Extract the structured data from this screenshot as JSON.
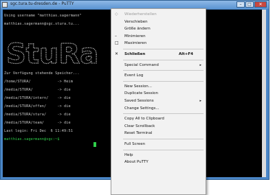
{
  "window": {
    "title": "sgc.tura.tu-dresden.de - PuTTY"
  },
  "terminal": {
    "lines": [
      "Using username \"matthias.sagermann\"",
      "matthias.sagermann@sgc.stura.tu...",
      "",
      "",
      "",
      "",
      "",
      "Zur Verfügung stehende Speicher...",
      "/home/STURA/            -> Heim",
      "/media/STURA/           -> die",
      "/media/STURA/intern/    -> die",
      "/media/STURA/offen/     -> die",
      "/media/STURA/stura/     -> die",
      "/media/STURA/team/      -> die",
      "Last login: Fri Dec  6 11:49:51",
      "matthias.sagermann@sgc:~$ "
    ],
    "banner_text": "StuRa",
    "cursor_color": "#2fcf4a"
  },
  "menu": {
    "items": [
      {
        "label": "Wiederherstellen",
        "icon": "restore-icon",
        "icon_char": "◇",
        "disabled": true
      },
      {
        "label": "Verschieben"
      },
      {
        "label": "Größe ändern"
      },
      {
        "label": "Minimieren",
        "icon": "minimize-icon",
        "icon_char": "–"
      },
      {
        "label": "Maximieren",
        "icon": "maximize-icon",
        "icon_char": "□"
      },
      {
        "sep": true
      },
      {
        "label": "Schließen",
        "icon": "close-icon",
        "icon_char": "✕",
        "shortcut": "Alt+F4",
        "bold": true
      },
      {
        "sep": true
      },
      {
        "label": "Special Command",
        "submenu": true
      },
      {
        "sep": true
      },
      {
        "label": "Event Log"
      },
      {
        "sep": true
      },
      {
        "label": "New Session..."
      },
      {
        "label": "Duplicate Session"
      },
      {
        "label": "Saved Sessions",
        "submenu": true
      },
      {
        "label": "Change Settings..."
      },
      {
        "sep": true
      },
      {
        "label": "Copy All to Clipboard"
      },
      {
        "label": "Clear Scrollback"
      },
      {
        "label": "Reset Terminal"
      },
      {
        "sep": true
      },
      {
        "label": "Full Screen"
      },
      {
        "sep": true
      },
      {
        "label": "Help"
      },
      {
        "label": "About PuTTY"
      }
    ]
  }
}
